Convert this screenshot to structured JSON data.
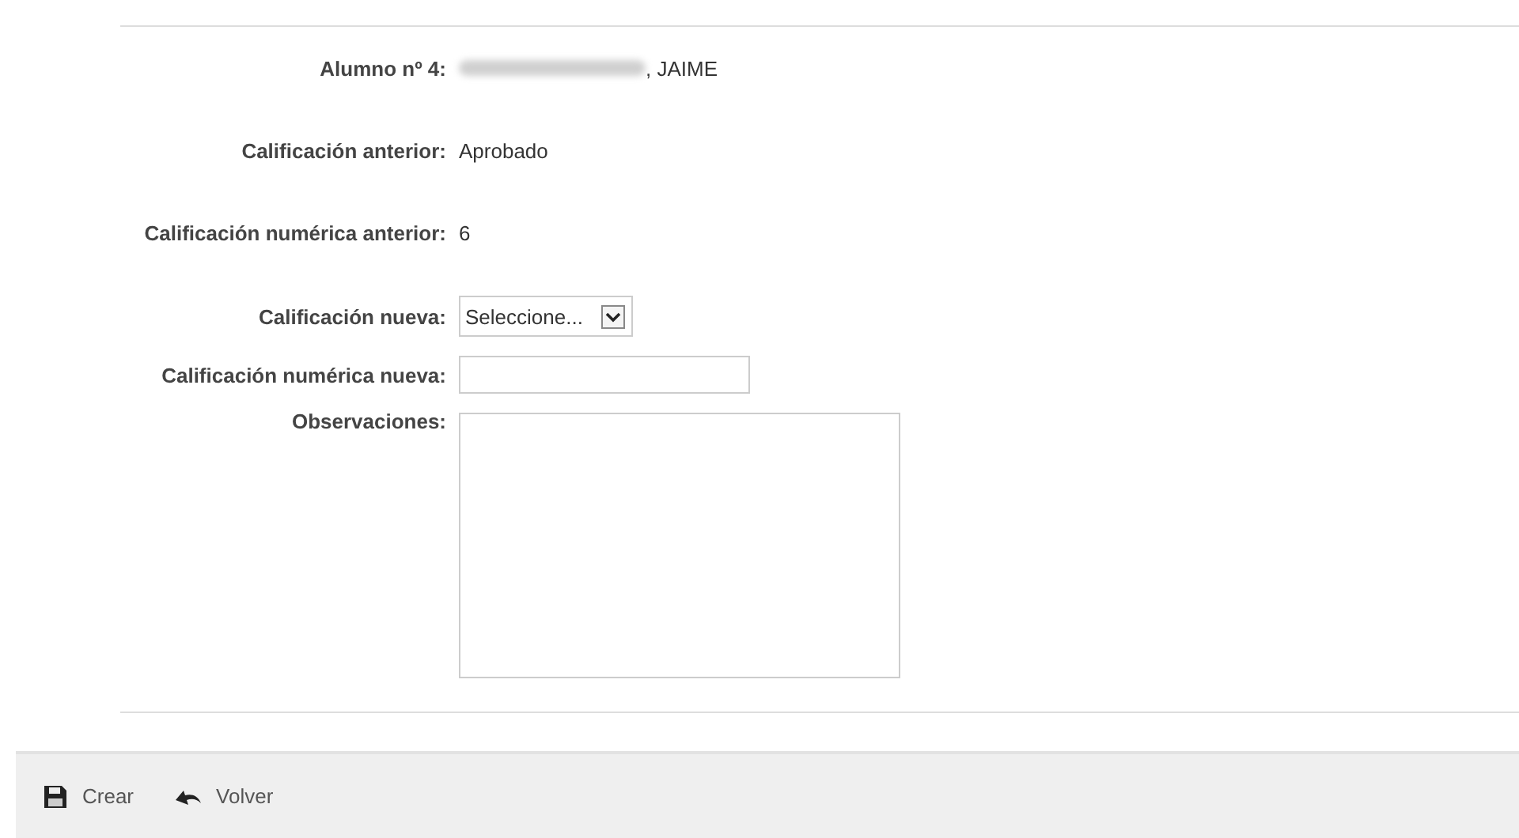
{
  "form": {
    "rows": [
      {
        "kind": "redacted_text",
        "label": "Alumno nº 4:",
        "value": ", JAIME"
      },
      {
        "kind": "text",
        "label": "Calificación anterior:",
        "value": "Aprobado"
      },
      {
        "kind": "text",
        "label": "Calificación numérica anterior:",
        "value": "6"
      },
      {
        "kind": "select",
        "label": "Calificación nueva:",
        "value": "Seleccione..."
      },
      {
        "kind": "input",
        "label": "Calificación numérica nueva:"
      },
      {
        "kind": "textarea",
        "label": "Observaciones:"
      }
    ]
  },
  "toolbar": [
    {
      "kind": "save",
      "label": "Crear"
    },
    {
      "kind": "back",
      "label": "Volver"
    }
  ]
}
